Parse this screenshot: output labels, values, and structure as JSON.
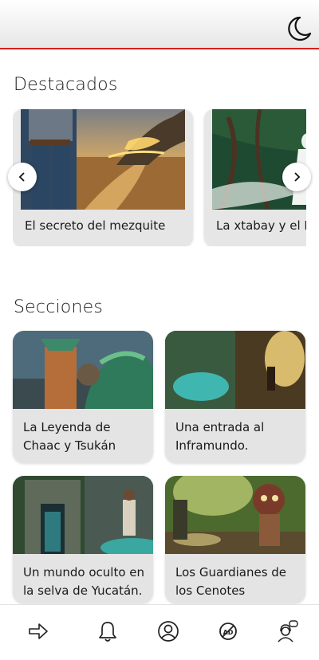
{
  "header": {
    "theme_icon": "moon-icon"
  },
  "featured": {
    "title": "Destacados",
    "items": [
      {
        "caption": "El secreto del mezquite"
      },
      {
        "caption": "La xtabay y el N"
      }
    ],
    "prev_icon": "chevron-left-icon",
    "next_icon": "chevron-right-icon"
  },
  "sections": {
    "title": "Secciones",
    "items": [
      {
        "line1": "La Leyenda de",
        "line2": "Chaac y Tsukán"
      },
      {
        "line1": "Una entrada al",
        "line2": "Inframundo."
      },
      {
        "line1": "Un mundo oculto en",
        "line2": "la selva de Yucatán."
      },
      {
        "line1": "Los Guardianes de",
        "line2": "los Cenotes"
      }
    ]
  },
  "bottom_nav": {
    "items": [
      "share-icon",
      "bell-icon",
      "user-icon",
      "no-ads-icon",
      "support-icon"
    ]
  },
  "colors": {
    "accent": "#d81e1e",
    "card_bg": "#e6e6e6"
  }
}
